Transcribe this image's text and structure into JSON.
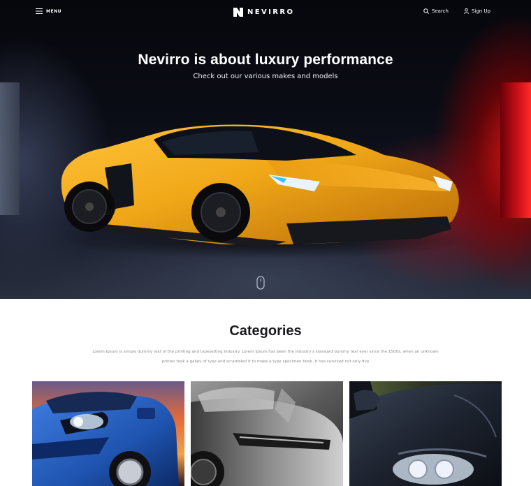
{
  "nav": {
    "menu_label": "MENU",
    "brand": "NEVIRRO",
    "search_label": "Search",
    "signup_label": "Sign Up"
  },
  "hero": {
    "title": "Nevirro is about luxury performance",
    "subtitle": "Check out our various makes and models"
  },
  "categories": {
    "title": "Categories",
    "description_line1": "Lorem Ipsum is simply dummy text of the printing and typesetting industry. Lorem Ipsum has been the industry's standard dummy text ever since the 1500s, when an unknown",
    "description_line2": "printer took a galley of type and scrambled it to make a type specimen book. It has survived not only five",
    "cards": [
      {
        "name": "blue-car-sunset"
      },
      {
        "name": "grey-sports-car"
      },
      {
        "name": "dark-car-headlight"
      }
    ]
  },
  "colors": {
    "hero_dark": "#0b0d16",
    "car_yellow": "#f0a818",
    "accent_red": "#d01018",
    "text_dark": "#1b1b1f",
    "text_muted": "#8a8a8f"
  },
  "icons": [
    "hamburger-icon",
    "logo-mark-icon",
    "search-icon",
    "user-icon",
    "mouse-scroll-icon"
  ]
}
